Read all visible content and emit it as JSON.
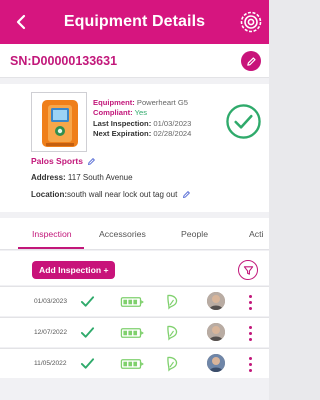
{
  "header": {
    "title": "Equipment Details",
    "back_icon": "chevron-left-icon",
    "settings_icon": "settings-icon"
  },
  "serial": {
    "text": "SN:D00000133631",
    "edit_icon": "pencil-icon"
  },
  "device": {
    "image_alt": "Powerheart G5 AED",
    "equipment_label": "Equipment:",
    "equipment_value": "Powerheart G5",
    "compliant_label": "Compliant:",
    "compliant_value": "Yes",
    "last_inspection_label": "Last Inspection:",
    "last_inspection_value": "01/03/2023",
    "next_expiration_label": "Next Expiration:",
    "next_expiration_value": "02/28/2024",
    "status_icon": "check-circle-icon"
  },
  "location": {
    "name": "Palos Sports",
    "address_label": "Address:",
    "address_value": "117  South  Avenue",
    "location_label": "Location:",
    "location_value": "south wall near lock out tag out"
  },
  "tabs": [
    {
      "label": "Inspection",
      "active": true
    },
    {
      "label": "Accessories",
      "active": false
    },
    {
      "label": "People",
      "active": false
    },
    {
      "label": "Acti",
      "active": false
    }
  ],
  "actions": {
    "add_label": "Add Inspection +",
    "filter_icon": "filter-icon"
  },
  "inspections": [
    {
      "date": "01/03/2023",
      "status_icon": "check-icon",
      "battery_icon": "battery-icon",
      "pad_icon": "pad-icon",
      "avatar": "avatar"
    },
    {
      "date": "12/07/2022",
      "status_icon": "check-icon",
      "battery_icon": "battery-icon",
      "pad_icon": "pad-icon",
      "avatar": "avatar"
    },
    {
      "date": "11/05/2022",
      "status_icon": "check-icon",
      "battery_icon": "battery-icon",
      "pad_icon": "pad-icon",
      "avatar": "avatar"
    }
  ],
  "colors": {
    "brand": "#d6157f",
    "accent_dark": "#c2177a",
    "success": "#2faa6b",
    "battery": "#7fd06d"
  }
}
